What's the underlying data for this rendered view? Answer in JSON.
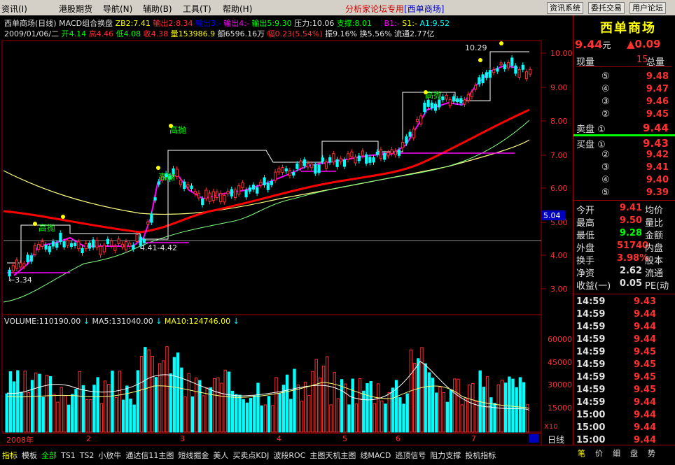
{
  "menu": {
    "items": [
      "资讯(I)",
      "港股期货",
      "导航(N)",
      "辅助(B)",
      "工具(T)",
      "帮助(H)"
    ],
    "center_title": "分析家论坛专用",
    "center_stock": "[西单商场]",
    "buttons": [
      "资讯系统",
      "委托交易",
      "用户论坛"
    ]
  },
  "header": {
    "line1": {
      "name": "西单商场(日线)",
      "indicator": "MACD组合换盘",
      "zb2": "ZB2:7.41",
      "out2": "输出2:8.34",
      "out3": "输出3:-",
      "out4": "输出4:-",
      "out5": "输出5:9.30",
      "pressure": "压力:10.06",
      "support": "支撑:8.01",
      "b1": "B1:-",
      "s1": "S1:-",
      "a1": "A1:9.52"
    },
    "line2": {
      "date": "2009/01/06/二",
      "open": "开4.14",
      "high": "高4.46",
      "low": "低4.08",
      "close": "收4.38",
      "vol": "量153986.9",
      "amt": "额6596.16万",
      "amp": "幅0.23(5.54%)",
      "swing": "振9.16%",
      "turnover": "换5.56%",
      "float": "流通2.77亿"
    }
  },
  "price_axis": [
    "10.00",
    "9.00",
    "8.00",
    "7.00",
    "6.00",
    "5.00",
    "4.00",
    "3.00"
  ],
  "price_marker": "5.04",
  "annotations": {
    "high": "10.29",
    "low": "3.34",
    "range": "4.41-4.42",
    "sell1": "高抛",
    "sell2": "高抛",
    "sell3": "高抛",
    "sell4": "高抛"
  },
  "volume_header": {
    "vol": "VOLUME:110190.00",
    "ma5": "MA5:131040.00",
    "ma10": "MA10:124746.00"
  },
  "volume_axis": [
    "60000",
    "45000",
    "30000",
    "15000"
  ],
  "volume_unit": "X10",
  "date_axis": {
    "year": "2008年",
    "months": [
      "2",
      "3",
      "4",
      "5",
      "6",
      "7"
    ]
  },
  "period": "日线",
  "colors": {
    "up": "#ff3030",
    "down": "#00ffff",
    "ma_red": "#ff0000",
    "ma_yellow": "#ffff80",
    "ma_green": "#80ff80",
    "magenta": "#ff00ff",
    "accent": "#ffff00"
  },
  "right_panel": {
    "title": "西单商场",
    "price": "9.44",
    "price_unit": "元",
    "change": "▲0.09",
    "labels": {
      "now_vol": "现量",
      "now_vol_val": "15",
      "total": "总量"
    },
    "asks": [
      {
        "lv": "⑤",
        "p": "9.48"
      },
      {
        "lv": "④",
        "p": "9.47"
      },
      {
        "lv": "③",
        "p": "9.46"
      },
      {
        "lv": "②",
        "p": "9.45"
      },
      {
        "lv": "卖盘 ①",
        "p": "9.44"
      }
    ],
    "bids": [
      {
        "lv": "买盘 ①",
        "p": "9.43"
      },
      {
        "lv": "②",
        "p": "9.42"
      },
      {
        "lv": "③",
        "p": "9.41"
      },
      {
        "lv": "④",
        "p": "9.40"
      },
      {
        "lv": "⑤",
        "p": "9.39"
      }
    ],
    "stats": [
      {
        "l": "今开",
        "v": "9.41",
        "r": "均价"
      },
      {
        "l": "最高",
        "v": "9.50",
        "r": "量比"
      },
      {
        "l": "最低",
        "v": "9.28",
        "r": "金额"
      },
      {
        "l": "外盘",
        "v": "51740",
        "r": "内盘"
      },
      {
        "l": "换手",
        "v": "3.98%",
        "r": "股本"
      },
      {
        "l": "净资",
        "v": "2.62",
        "r": "流通"
      },
      {
        "l": "收益(一)",
        "v": "0.05",
        "r": "PE(动"
      }
    ],
    "ticks": [
      {
        "t": "14:59",
        "p": "9.43"
      },
      {
        "t": "14:59",
        "p": "9.44"
      },
      {
        "t": "14:59",
        "p": "9.44"
      },
      {
        "t": "14:59",
        "p": "9.44"
      },
      {
        "t": "14:59",
        "p": "9.45"
      },
      {
        "t": "14:59",
        "p": "9.45"
      },
      {
        "t": "14:59",
        "p": "9.45"
      },
      {
        "t": "14:59",
        "p": "9.45"
      },
      {
        "t": "14:59",
        "p": "9.44"
      },
      {
        "t": "15:00",
        "p": "9.44"
      },
      {
        "t": "15:00",
        "p": "9.44"
      },
      {
        "t": "15:00",
        "p": "9.44"
      }
    ],
    "bottom_tabs": [
      "笔",
      "价",
      "细",
      "盘",
      "势"
    ]
  },
  "tabs": [
    "指标",
    "模板",
    "全部",
    "TS1",
    "TS2",
    "小放牛",
    "通达信11主图",
    "短线掘金",
    "美人",
    "买卖点KDJ",
    "波段ROC",
    "主图天机主图",
    "线MACD",
    "逃顶信号",
    "阻力支撑",
    "投机指标"
  ]
}
